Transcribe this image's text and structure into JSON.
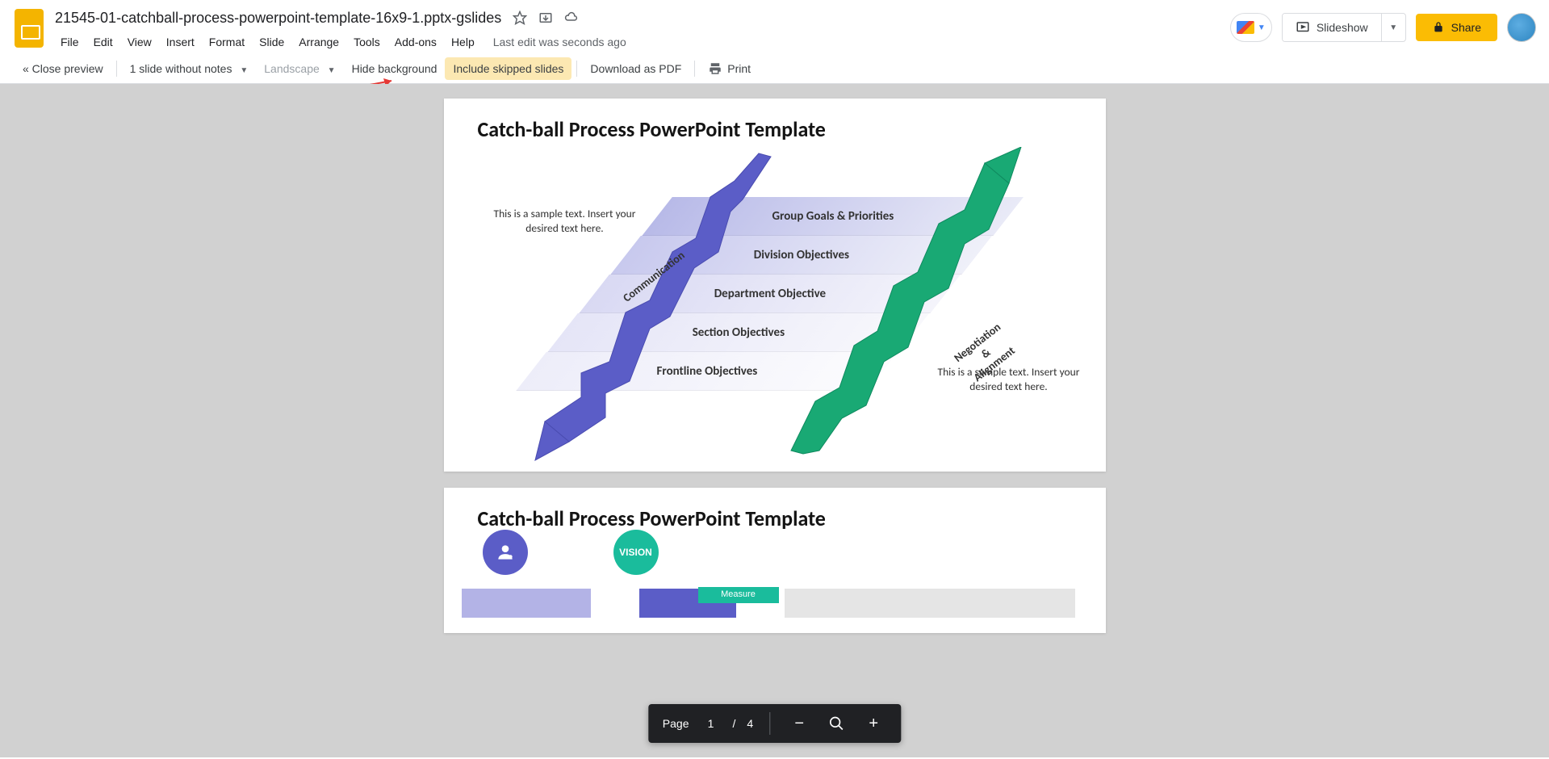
{
  "doc": {
    "title": "21545-01-catchball-process-powerpoint-template-16x9-1.pptx-gslides"
  },
  "menu": {
    "file": "File",
    "edit": "Edit",
    "view": "View",
    "insert": "Insert",
    "format": "Format",
    "slide": "Slide",
    "arrange": "Arrange",
    "tools": "Tools",
    "addons": "Add-ons",
    "help": "Help",
    "last_edit": "Last edit was seconds ago"
  },
  "header_right": {
    "slideshow": "Slideshow",
    "share": "Share"
  },
  "toolbar": {
    "close_preview": "« Close preview",
    "slides_mode": "1 slide without notes",
    "orientation": "Landscape",
    "hide_bg": "Hide background",
    "include_skipped": "Include skipped slides",
    "download_pdf": "Download as PDF",
    "print": "Print"
  },
  "slide1": {
    "title": "Catch-ball Process PowerPoint Template",
    "sample_left": "This is a sample text. Insert your desired text here.",
    "sample_right": "This is a sample text. Insert your desired text here.",
    "levels": {
      "l1": "Group Goals & Priorities",
      "l2": "Division Objectives",
      "l3": "Department Objective",
      "l4": "Section Objectives",
      "l5": "Frontline Objectives"
    },
    "left_arrow_label": "Communication",
    "right_arrow_label1": "Negotiation &",
    "right_arrow_label2": "Alignment"
  },
  "slide2": {
    "title": "Catch-ball Process PowerPoint Template",
    "vision": "VISION",
    "measure": "Measure"
  },
  "zoom": {
    "page_label": "Page",
    "current": "1",
    "sep": "/",
    "total": "4"
  }
}
